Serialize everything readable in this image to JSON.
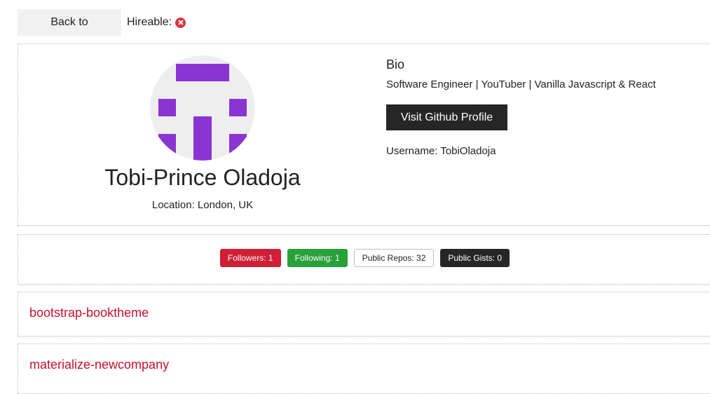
{
  "nav": {
    "back_label": "Back to Search",
    "hireable_label": "Hireable:",
    "hireable_icon": "x-circle-icon"
  },
  "profile": {
    "name": "Tobi-Prince Oladoja",
    "location": "Location: London, UK",
    "bio_heading": "Bio",
    "bio_text": "Software Engineer | YouTuber | Vanilla Javascript & React",
    "visit_button": "Visit Github Profile",
    "username": "Username: TobiOladoja"
  },
  "badges": [
    {
      "label": "Followers: 1",
      "color": "#d01f35"
    },
    {
      "label": "Following: 1",
      "color": "#28a03c"
    },
    {
      "label": "Public Repos: 32",
      "color": "#ffffff"
    },
    {
      "label": "Public Gists: 0",
      "color": "#262626"
    }
  ],
  "repos": [
    {
      "name": "bootstrap-booktheme"
    },
    {
      "name": "materialize-newcompany"
    }
  ],
  "colors": {
    "accent": "#c8102e",
    "avatar_pattern": "#8a35d1"
  }
}
